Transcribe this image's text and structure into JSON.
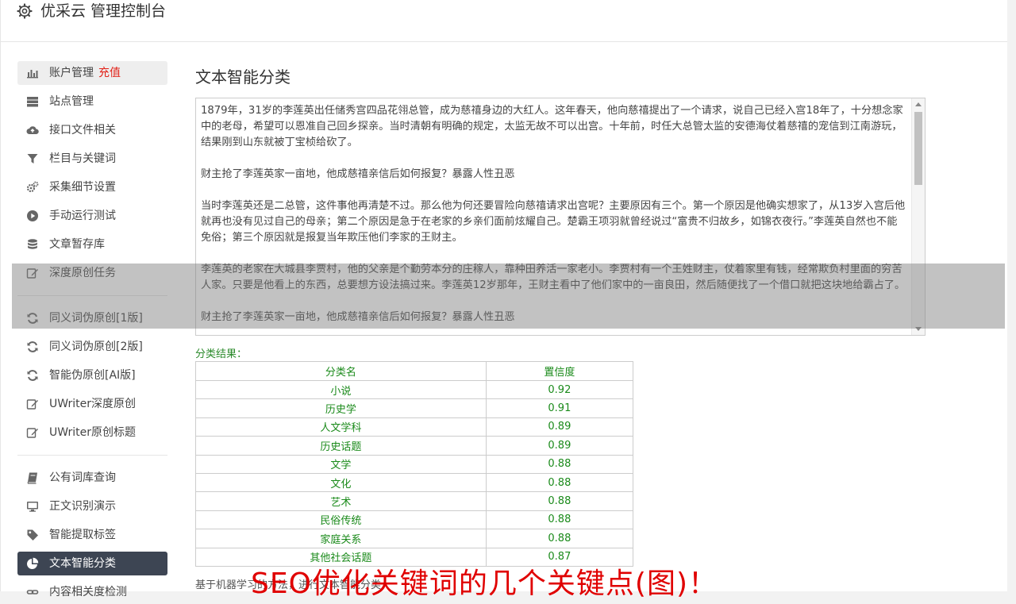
{
  "app": {
    "title": "优采云 管理控制台"
  },
  "sidebar": {
    "items": [
      {
        "label": "账户管理",
        "badge": "充值",
        "icon": "bar-chart-icon"
      },
      {
        "label": "站点管理",
        "icon": "server-icon"
      },
      {
        "label": "接口文件相关",
        "icon": "cloud-upload-icon"
      },
      {
        "label": "栏目与关键词",
        "icon": "filter-icon"
      },
      {
        "label": "采集细节设置",
        "icon": "gears-icon"
      },
      {
        "label": "手动运行测试",
        "icon": "play-icon"
      },
      {
        "label": "文章暂存库",
        "icon": "database-icon"
      },
      {
        "label": "深度原创任务",
        "icon": "edit-icon"
      },
      {
        "label": "同义词伪原创[1版]",
        "icon": "refresh-icon"
      },
      {
        "label": "同义词伪原创[2版]",
        "icon": "refresh-icon"
      },
      {
        "label": "智能伪原创[AI版]",
        "icon": "refresh-icon"
      },
      {
        "label": "UWriter深度原创",
        "icon": "edit-icon"
      },
      {
        "label": "UWriter原创标题",
        "icon": "edit-icon"
      },
      {
        "label": "公有词库查询",
        "icon": "book-icon"
      },
      {
        "label": "正文识别演示",
        "icon": "monitor-icon"
      },
      {
        "label": "智能提取标签",
        "icon": "tag-icon"
      },
      {
        "label": "文本智能分类",
        "icon": "pie-chart-icon"
      },
      {
        "label": "内容相关度检测",
        "icon": "link-icon"
      }
    ]
  },
  "main": {
    "title": "文本智能分类",
    "text_paragraphs": [
      "1879年，31岁的李莲英出任储秀宫四品花翎总管，成为慈禧身边的大红人。这年春天，他向慈禧提出了一个请求，说自己已经入宫18年了，十分想念家中的老母，希望可以恩准自己回乡探亲。当时清朝有明确的规定，太监无故不可以出宫。十年前，时任大总管太监的安德海仗着慈禧的宠信到江南游玩，结果刚到山东就被丁宝桢给砍了。",
      "财主抢了李莲英家一亩地，他成慈禧亲信后如何报复？暴露人性丑恶",
      "当时李莲英还是二总管，这件事他再清楚不过。那么他为何还要冒险向慈禧请求出宫呢？主要原因有三个。第一个原因是他确实想家了，从13岁入宫后他就再也没有见过自己的母亲；第二个原因是急于在老家的乡亲们面前炫耀自己。楚霸王项羽就曾经说过“富贵不归故乡，如锦衣夜行。”李莲英自然也不能免俗；第三个原因就是报复当年欺压他们李家的王财主。",
      "李莲英的老家在大城县李贾村，他的父亲是个勤劳本分的庄稼人，靠种田养活一家老小。李贾村有一个王姓财主，仗着家里有钱，经常欺负村里面的穷苦人家。只要是他看上的东西，总要想方设法搞过来。李莲英12岁那年，王财主看中了他们家中的一亩良田，然后随便找了一个借口就把这块地给霸占了。",
      "财主抢了李莲英家一亩地，他成慈禧亲信后如何报复？暴露人性丑恶"
    ],
    "result_label": "分类结果：",
    "table": {
      "headers": [
        "分类名",
        "置信度"
      ],
      "rows": [
        [
          "小说",
          "0.92"
        ],
        [
          "历史学",
          "0.91"
        ],
        [
          "人文学科",
          "0.89"
        ],
        [
          "历史话题",
          "0.89"
        ],
        [
          "文学",
          "0.88"
        ],
        [
          "文化",
          "0.88"
        ],
        [
          "艺术",
          "0.88"
        ],
        [
          "民俗传统",
          "0.88"
        ],
        [
          "家庭关系",
          "0.88"
        ],
        [
          "其他社会话题",
          "0.87"
        ]
      ]
    },
    "footnote": "基于机器学习的方法，进行文本智能分类",
    "watermark": "SEO优化关键词的几个关键点(图)！"
  },
  "colors": {
    "accent_active": "#3d4553",
    "result_green": "#1a8a1a",
    "badge_red": "#e2231a",
    "watermark_red": "#e00000"
  }
}
